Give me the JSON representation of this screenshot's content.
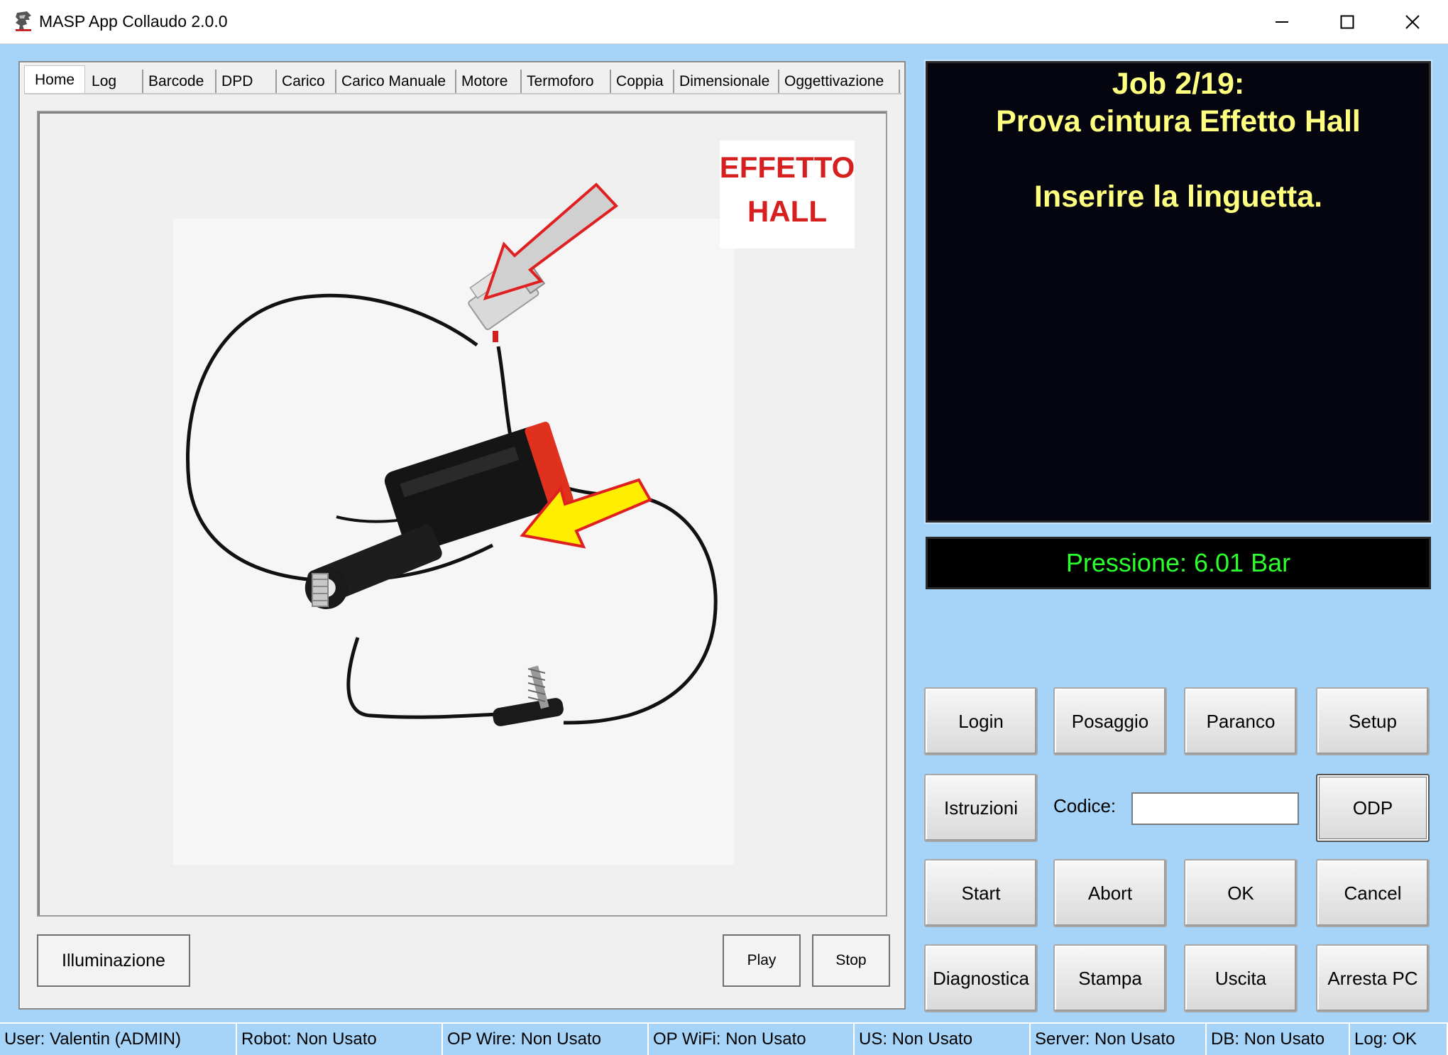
{
  "window": {
    "title": "MASP App Collaudo 2.0.0",
    "icon": "app-logo-icon",
    "controls": [
      "minimize-icon",
      "maximize-icon",
      "close-icon"
    ]
  },
  "tabs": [
    {
      "label": "Home",
      "active": true
    },
    {
      "label": "Log"
    },
    {
      "label": "Barcode"
    },
    {
      "label": "DPD"
    },
    {
      "label": "Carico"
    },
    {
      "label": "Carico Manuale"
    },
    {
      "label": "Motore"
    },
    {
      "label": "Termoforo"
    },
    {
      "label": "Coppia"
    },
    {
      "label": "Dimensionale"
    },
    {
      "label": "Oggettivazione"
    }
  ],
  "image": {
    "caption_line1": "EFFETTO",
    "caption_line2": "HALL"
  },
  "left_buttons": {
    "illuminazione": "Illuminazione",
    "play": "Play",
    "stop": "Stop"
  },
  "job_display": {
    "line1": "Job 2/19:",
    "line2": "Prova cintura Effetto Hall",
    "line3": "Inserire la linguetta."
  },
  "pressure": "Pressione: 6.01 Bar",
  "buttons": {
    "login": "Login",
    "posaggio": "Posaggio",
    "paranco": "Paranco",
    "setup": "Setup",
    "istruzioni": "Istruzioni",
    "odp": "ODP",
    "start": "Start",
    "abort": "Abort",
    "ok": "OK",
    "cancel": "Cancel",
    "diagnostica": "Diagnostica",
    "stampa": "Stampa",
    "uscita": "Uscita",
    "arresta_pc": "Arresta PC"
  },
  "codice": {
    "label": "Codice:",
    "value": ""
  },
  "status": {
    "user": "User: Valentin (ADMIN)",
    "robot": "Robot: Non Usato",
    "op_wire": "OP Wire: Non Usato",
    "op_wifi": "OP WiFi: Non Usato",
    "us": "US: Non Usato",
    "server": "Server: Non Usato",
    "db": "DB: Non Usato",
    "log": "Log: OK"
  },
  "colors": {
    "background": "#a6d4f8",
    "job_text": "#ffff80",
    "pressure_text": "#2bff2b",
    "display_bg": "#050510"
  }
}
